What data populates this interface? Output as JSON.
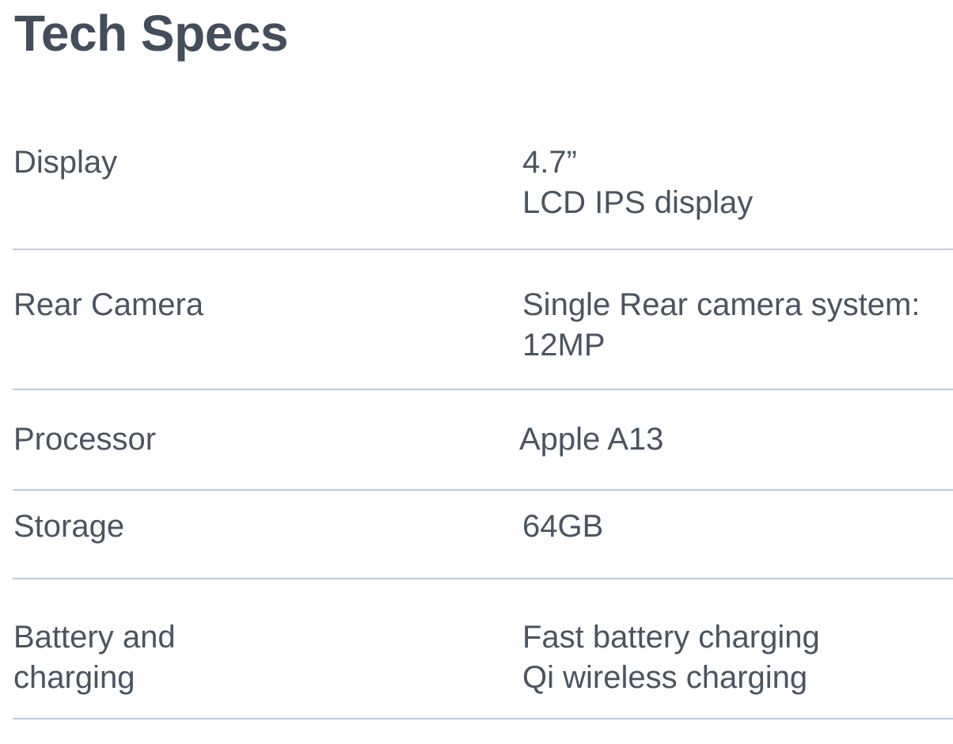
{
  "page": {
    "title": "Tech Specs"
  },
  "specs": [
    {
      "label_lines": [
        "Display"
      ],
      "value_lines": [
        "4.7”",
        "LCD IPS display"
      ]
    },
    {
      "label_lines": [
        "Rear Camera"
      ],
      "value_lines": [
        "Single Rear camera system:",
        "12MP"
      ]
    },
    {
      "label_lines": [
        "Processor"
      ],
      "value_lines": [
        "Apple A13"
      ]
    },
    {
      "label_lines": [
        "Storage"
      ],
      "value_lines": [
        "64GB"
      ]
    },
    {
      "label_lines": [
        "Battery and",
        "charging"
      ],
      "value_lines": [
        "Fast battery charging",
        "Qi wireless charging"
      ]
    }
  ],
  "colors": {
    "text": "#4b5460",
    "title": "#434d5b",
    "divider": "#b9cde3"
  }
}
